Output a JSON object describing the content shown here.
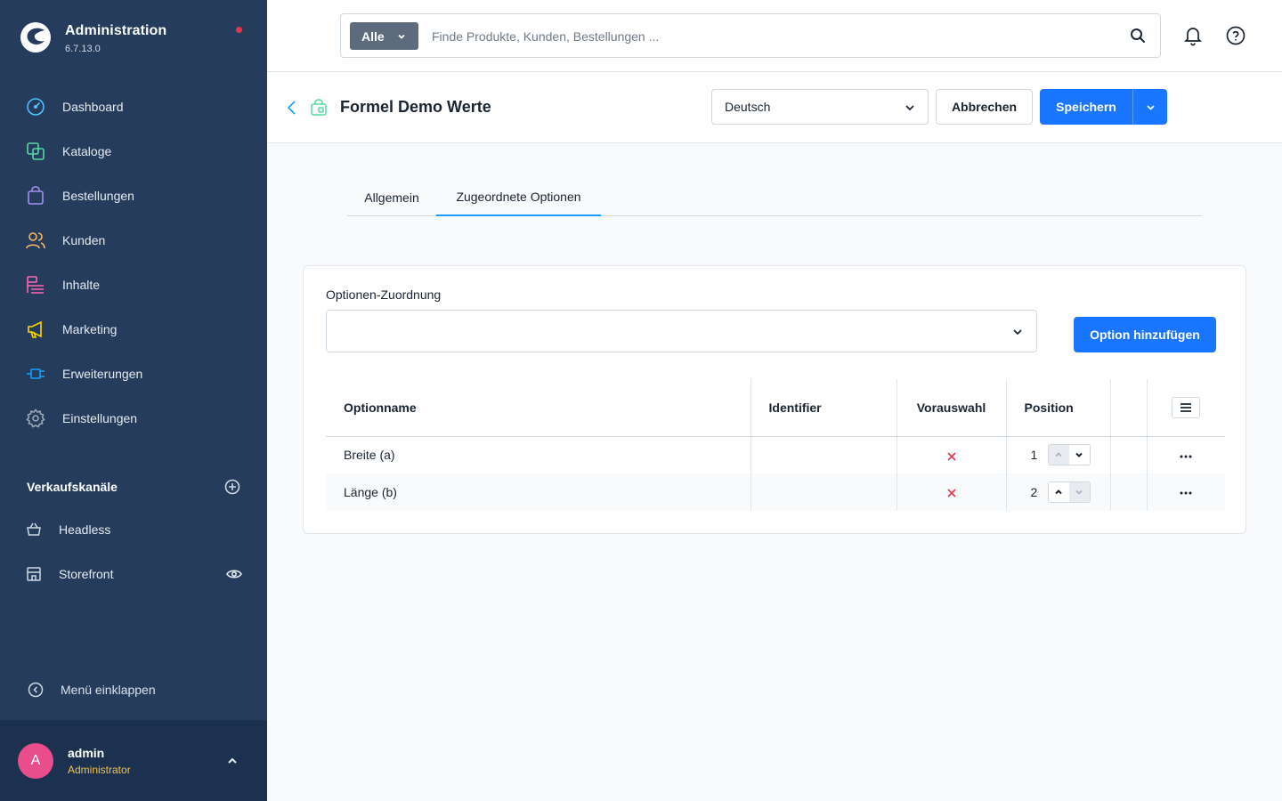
{
  "app": {
    "title": "Administration",
    "version": "6.7.13.0"
  },
  "nav": {
    "items": [
      {
        "label": "Dashboard"
      },
      {
        "label": "Kataloge"
      },
      {
        "label": "Bestellungen"
      },
      {
        "label": "Kunden"
      },
      {
        "label": "Inhalte"
      },
      {
        "label": "Marketing"
      },
      {
        "label": "Erweiterungen"
      },
      {
        "label": "Einstellungen"
      }
    ],
    "icon_colors": [
      "#52c1ff",
      "#57d9a3",
      "#a092f0",
      "#ffb75d",
      "#ff68b4",
      "#ffd700",
      "#189eff",
      "#9aa8b5"
    ],
    "channels_title": "Verkaufskanäle",
    "channels": [
      {
        "label": "Headless"
      },
      {
        "label": "Storefront"
      }
    ],
    "collapse_label": "Menü einklappen"
  },
  "user": {
    "initial": "A",
    "name": "admin",
    "role": "Administrator"
  },
  "search": {
    "type_label": "Alle",
    "placeholder": "Finde Produkte, Kunden, Bestellungen ..."
  },
  "header": {
    "title": "Formel Demo Werte",
    "language": "Deutsch",
    "cancel_label": "Abbrechen",
    "save_label": "Speichern"
  },
  "tabs": [
    {
      "label": "Allgemein"
    },
    {
      "label": "Zugeordnete Optionen"
    }
  ],
  "options": {
    "field_label": "Optionen-Zuordnung",
    "add_label": "Option hinzufügen",
    "columns": {
      "name": "Optionname",
      "identifier": "Identifier",
      "preselect": "Vorauswahl",
      "position": "Position"
    },
    "rows": [
      {
        "name": "Breite (a)",
        "identifier": "",
        "position": "1"
      },
      {
        "name": "Länge (b)",
        "identifier": "",
        "position": "2"
      }
    ]
  },
  "colors": {
    "accent": "#1a76ff",
    "sidebar": "#253c5c",
    "danger": "#e5364b"
  }
}
